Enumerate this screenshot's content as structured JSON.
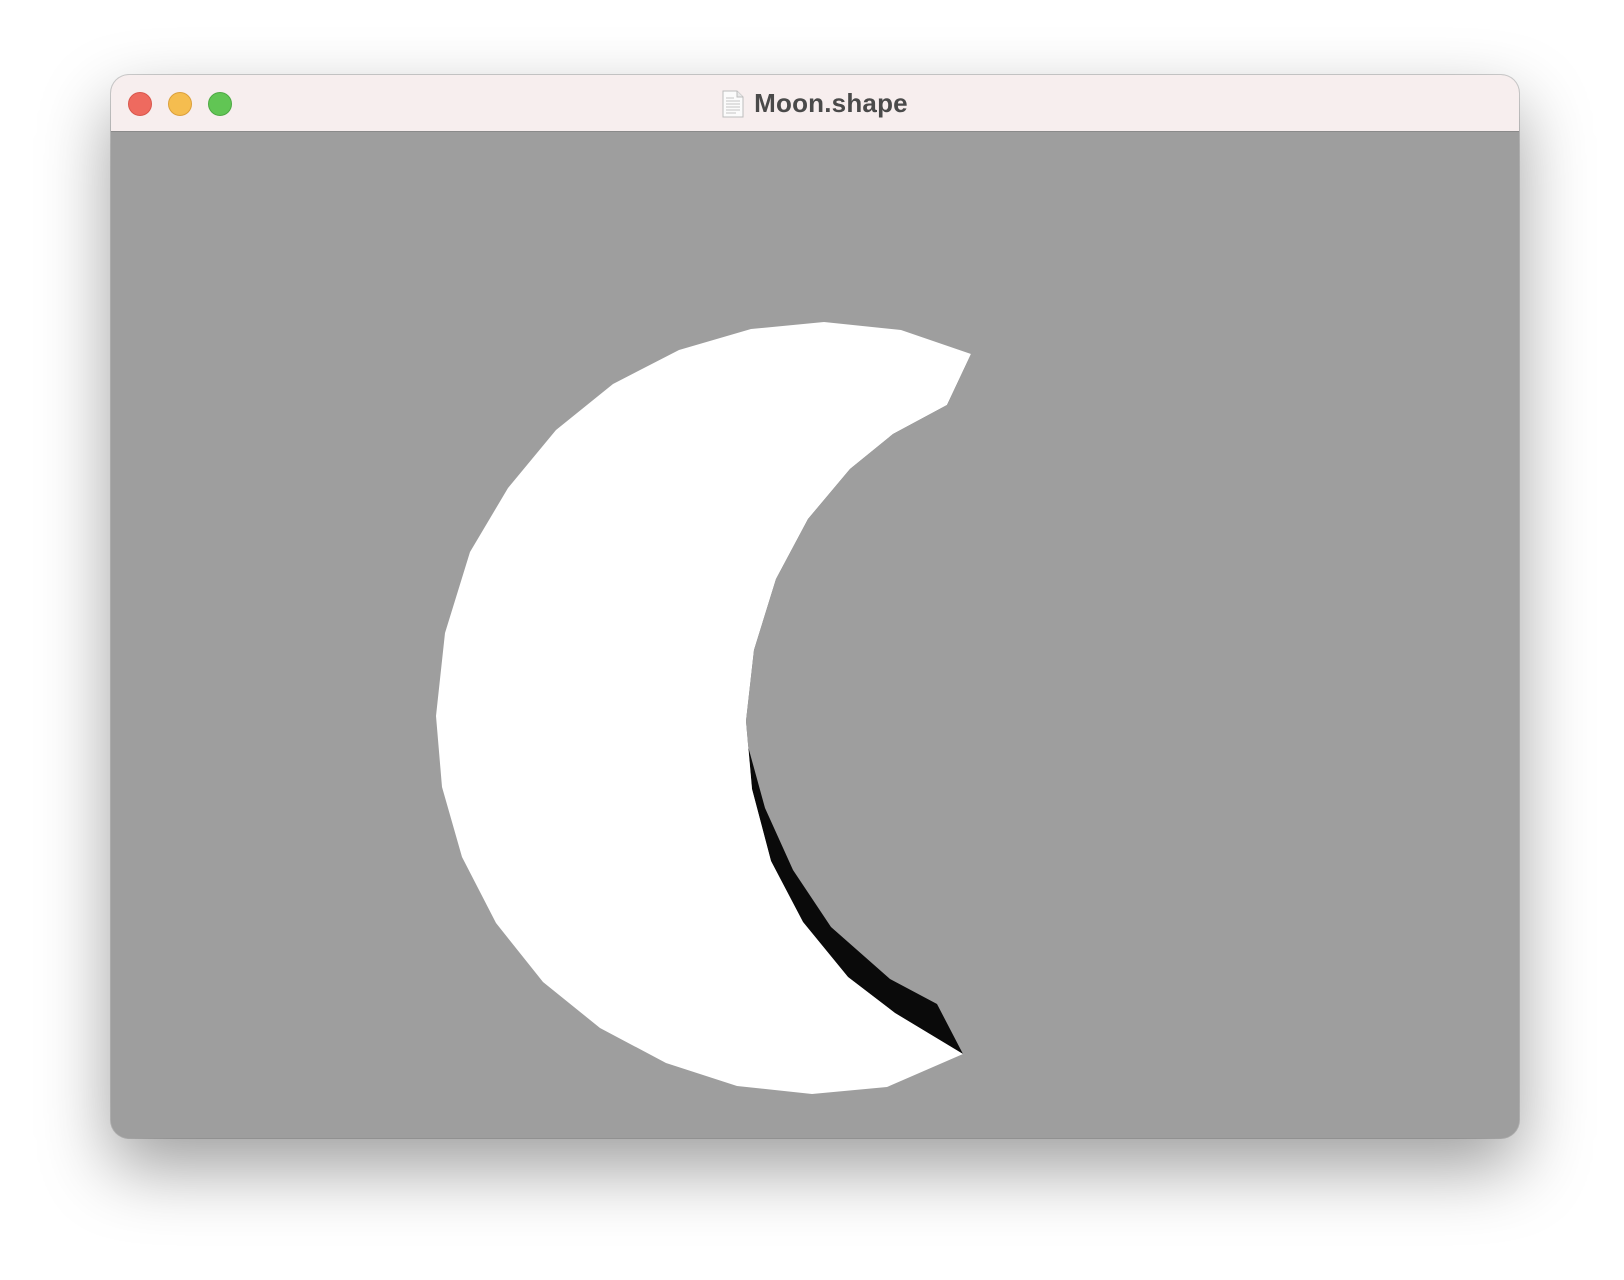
{
  "window": {
    "title": "Moon.shape",
    "title_icon": "document-icon",
    "controls": [
      "close",
      "minimize",
      "zoom"
    ]
  },
  "canvas": {
    "background_color": "#9e9e9e",
    "shape": {
      "name": "moon",
      "fill_color": "#ffffff",
      "shadow_color": "#0a0a0a"
    }
  }
}
